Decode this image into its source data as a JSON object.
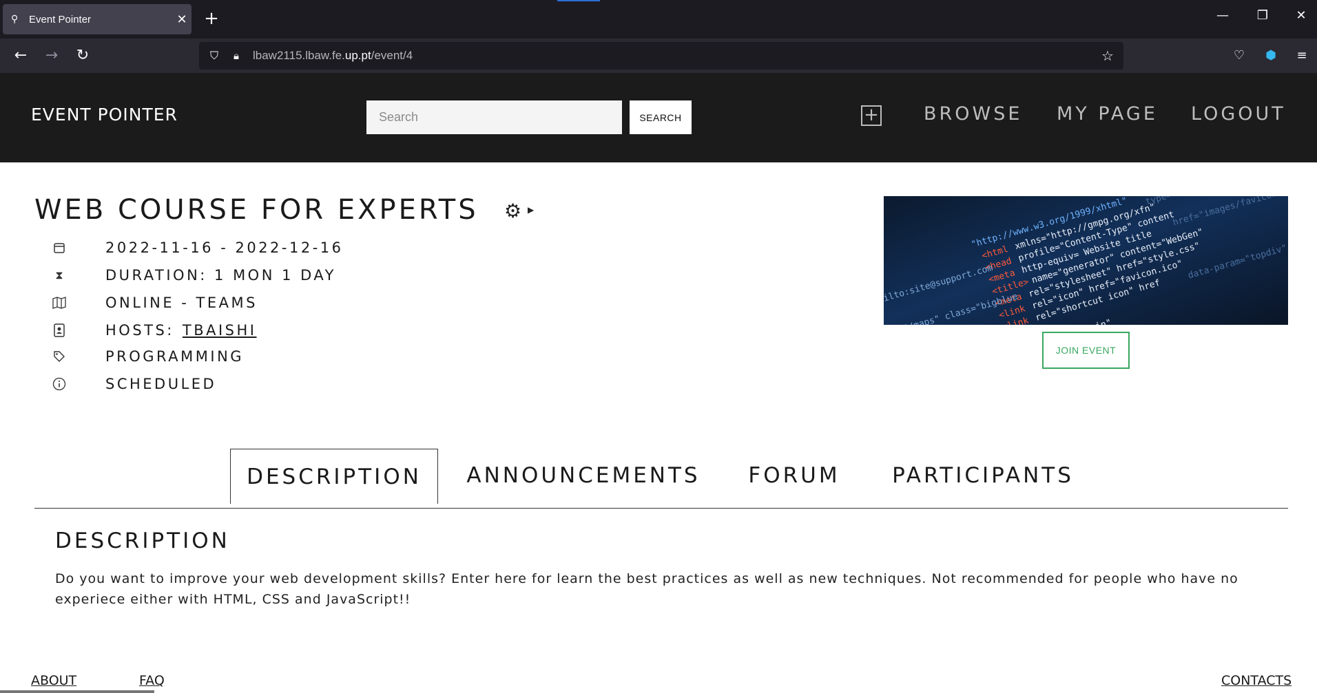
{
  "browser": {
    "tab_title": "Event Pointer",
    "url_prefix": "lbaw2115.lbaw.fe.",
    "url_domain": "up.pt",
    "url_path": "/event/4"
  },
  "header": {
    "brand": "EVENT POINTER",
    "search_placeholder": "Search",
    "search_button": "SEARCH",
    "nav": [
      "BROWSE",
      "MY PAGE",
      "LOGOUT"
    ]
  },
  "event": {
    "title": "WEB COURSE FOR EXPERTS",
    "dates": "2022-11-16 - 2022-12-16",
    "duration": "DURATION: 1 MON 1 DAY",
    "location": "ONLINE - TEAMS",
    "hosts_label": "HOSTS:",
    "host": "TBAISHI",
    "tag": "PROGRAMMING",
    "status": "SCHEDULED",
    "join_button": "JOIN EVENT"
  },
  "tabs": [
    "DESCRIPTION",
    "ANNOUNCEMENTS",
    "FORUM",
    "PARTICIPANTS"
  ],
  "description": {
    "title": "DESCRIPTION",
    "text": "Do you want to improve your web development skills? Enter here for learn the best practices as well as new techniques. Not recommended for people who have no experiece either with HTML, CSS and JavaScript!!"
  },
  "footer": {
    "about": "ABOUT",
    "faq": "FAQ",
    "contacts": "CONTACTS"
  },
  "colors": {
    "header_bg": "#1b1b1b",
    "join_green": "#3aa760"
  }
}
